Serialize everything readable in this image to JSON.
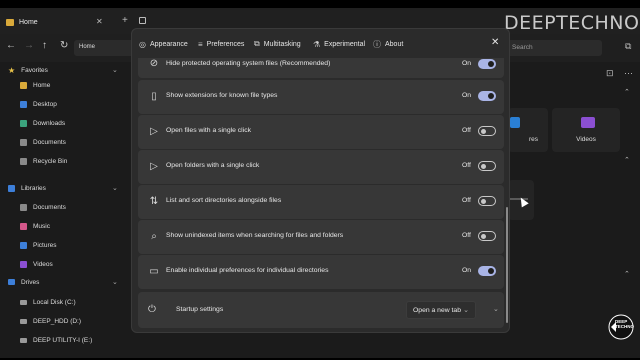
{
  "explorer": {
    "tab_title": "Home",
    "address": "Home",
    "search_placeholder": "Search",
    "sidebar": {
      "favorites_label": "Favorites",
      "favorites": [
        {
          "label": "Home",
          "color": "#d9a93a"
        },
        {
          "label": "Desktop",
          "color": "#3d7fd9"
        },
        {
          "label": "Downloads",
          "color": "#3ba37d"
        },
        {
          "label": "Documents",
          "color": "#8a8a8a"
        },
        {
          "label": "Recycle Bin",
          "color": "#8a8a8a"
        }
      ],
      "libraries_label": "Libraries",
      "libraries": [
        {
          "label": "Documents",
          "color": "#8a8a8a"
        },
        {
          "label": "Music",
          "color": "#d4578a"
        },
        {
          "label": "Pictures",
          "color": "#3d7fd9"
        },
        {
          "label": "Videos",
          "color": "#8b4fd2"
        }
      ],
      "drives_label": "Drives",
      "drives": [
        {
          "label": "Local Disk (C:)"
        },
        {
          "label": "DEEP_HDD (D:)"
        },
        {
          "label": "DEEP UTILITY-I (E:)"
        }
      ]
    },
    "tiles": {
      "partial_label": "res",
      "videos_label": "Videos"
    }
  },
  "logo": {
    "text": "DEEPTECHNO",
    "small_text": "DEEP TECHNO"
  },
  "dialog": {
    "tabs": [
      {
        "label": "Appearance",
        "icon": "palette-icon"
      },
      {
        "label": "Preferences",
        "icon": "sliders-icon"
      },
      {
        "label": "Multitasking",
        "icon": "windows-icon"
      },
      {
        "label": "Experimental",
        "icon": "flask-icon"
      },
      {
        "label": "About",
        "icon": "info-icon"
      }
    ],
    "rows": [
      {
        "label": "Hide protected operating system files (Recommended)",
        "state": "On",
        "on": true,
        "icon": "hidden-eye-icon"
      },
      {
        "label": "Show extensions for known file types",
        "state": "On",
        "on": true,
        "icon": "file-icon"
      },
      {
        "label": "Open files with a single click",
        "state": "Off",
        "on": false,
        "icon": "pointer-icon"
      },
      {
        "label": "Open folders with a single click",
        "state": "Off",
        "on": false,
        "icon": "pointer-icon"
      },
      {
        "label": "List and sort directories alongside files",
        "state": "Off",
        "on": false,
        "icon": "sort-icon"
      },
      {
        "label": "Show unindexed items when searching for files and folders",
        "state": "Off",
        "on": false,
        "icon": "search-icon"
      },
      {
        "label": "Enable individual preferences for individual directories",
        "state": "On",
        "on": true,
        "icon": "folder-icon"
      }
    ],
    "startup": {
      "label": "Startup settings",
      "value": "Open a new tab"
    }
  }
}
